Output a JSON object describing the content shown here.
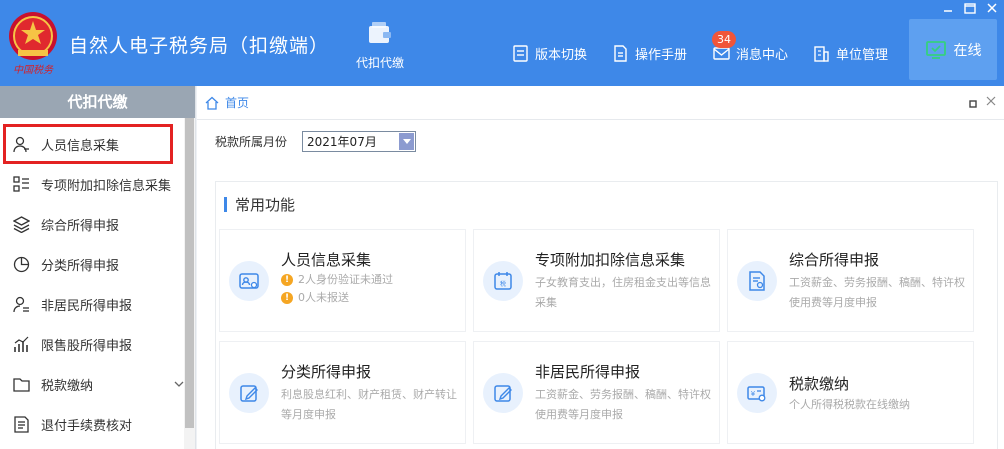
{
  "header": {
    "app_title": "自然人电子税务局（扣缴端）",
    "logo_text": "中国税务",
    "nav_agent_label": "代扣代缴",
    "toolbar": [
      {
        "label": "版本切换",
        "icon": "version-icon"
      },
      {
        "label": "操作手册",
        "icon": "manual-icon"
      },
      {
        "label": "消息中心",
        "icon": "mail-icon"
      },
      {
        "label": "单位管理",
        "icon": "building-icon"
      }
    ],
    "message_badge": "34",
    "online_label": "在线"
  },
  "sidebar": {
    "title": "代扣代缴",
    "items": [
      {
        "label": "人员信息采集",
        "icon": "user-icon",
        "selected": true
      },
      {
        "label": "专项附加扣除信息采集",
        "icon": "list-icon"
      },
      {
        "label": "综合所得申报",
        "icon": "layers-icon"
      },
      {
        "label": "分类所得申报",
        "icon": "pie-icon"
      },
      {
        "label": "非居民所得申报",
        "icon": "person-icon"
      },
      {
        "label": "限售股所得申报",
        "icon": "bar-chart-icon"
      },
      {
        "label": "税款缴纳",
        "icon": "folder-icon",
        "expandable": true
      },
      {
        "label": "退付手续费核对",
        "icon": "document-icon"
      }
    ]
  },
  "main": {
    "breadcrumb": "首页",
    "filter_label": "税款所属月份",
    "month_value": "2021年07月",
    "panel_title": "常用功能",
    "cards": [
      {
        "title": "人员信息采集",
        "warnings": [
          "2人身份验证未通过",
          "0人未报送"
        ],
        "icon": "id-card-icon"
      },
      {
        "title": "专项附加扣除信息采集",
        "desc": "子女教育支出，住房租金支出等信息采集",
        "icon": "tax-calendar-icon"
      },
      {
        "title": "综合所得申报",
        "desc": "工资薪金、劳务报酬、稿酬、特许权使用费等月度申报",
        "icon": "document-icon"
      },
      {
        "title": "分类所得申报",
        "desc": "利息股息红利、财产租赁、财产转让等月度申报",
        "icon": "edit-icon"
      },
      {
        "title": "非居民所得申报",
        "desc": "工资薪金、劳务报酬、稿酬、特许权使用费等月度申报",
        "icon": "edit-icon"
      },
      {
        "title": "税款缴纳",
        "desc": "个人所得税税款在线缴纳",
        "icon": "payment-icon"
      }
    ]
  },
  "colors": {
    "header_blue": "#3e88e8",
    "sidebar_head": "#9aa6b3",
    "selected_outline": "#e32222",
    "badge_red": "#f0553a",
    "warning_orange": "#f5a623"
  }
}
